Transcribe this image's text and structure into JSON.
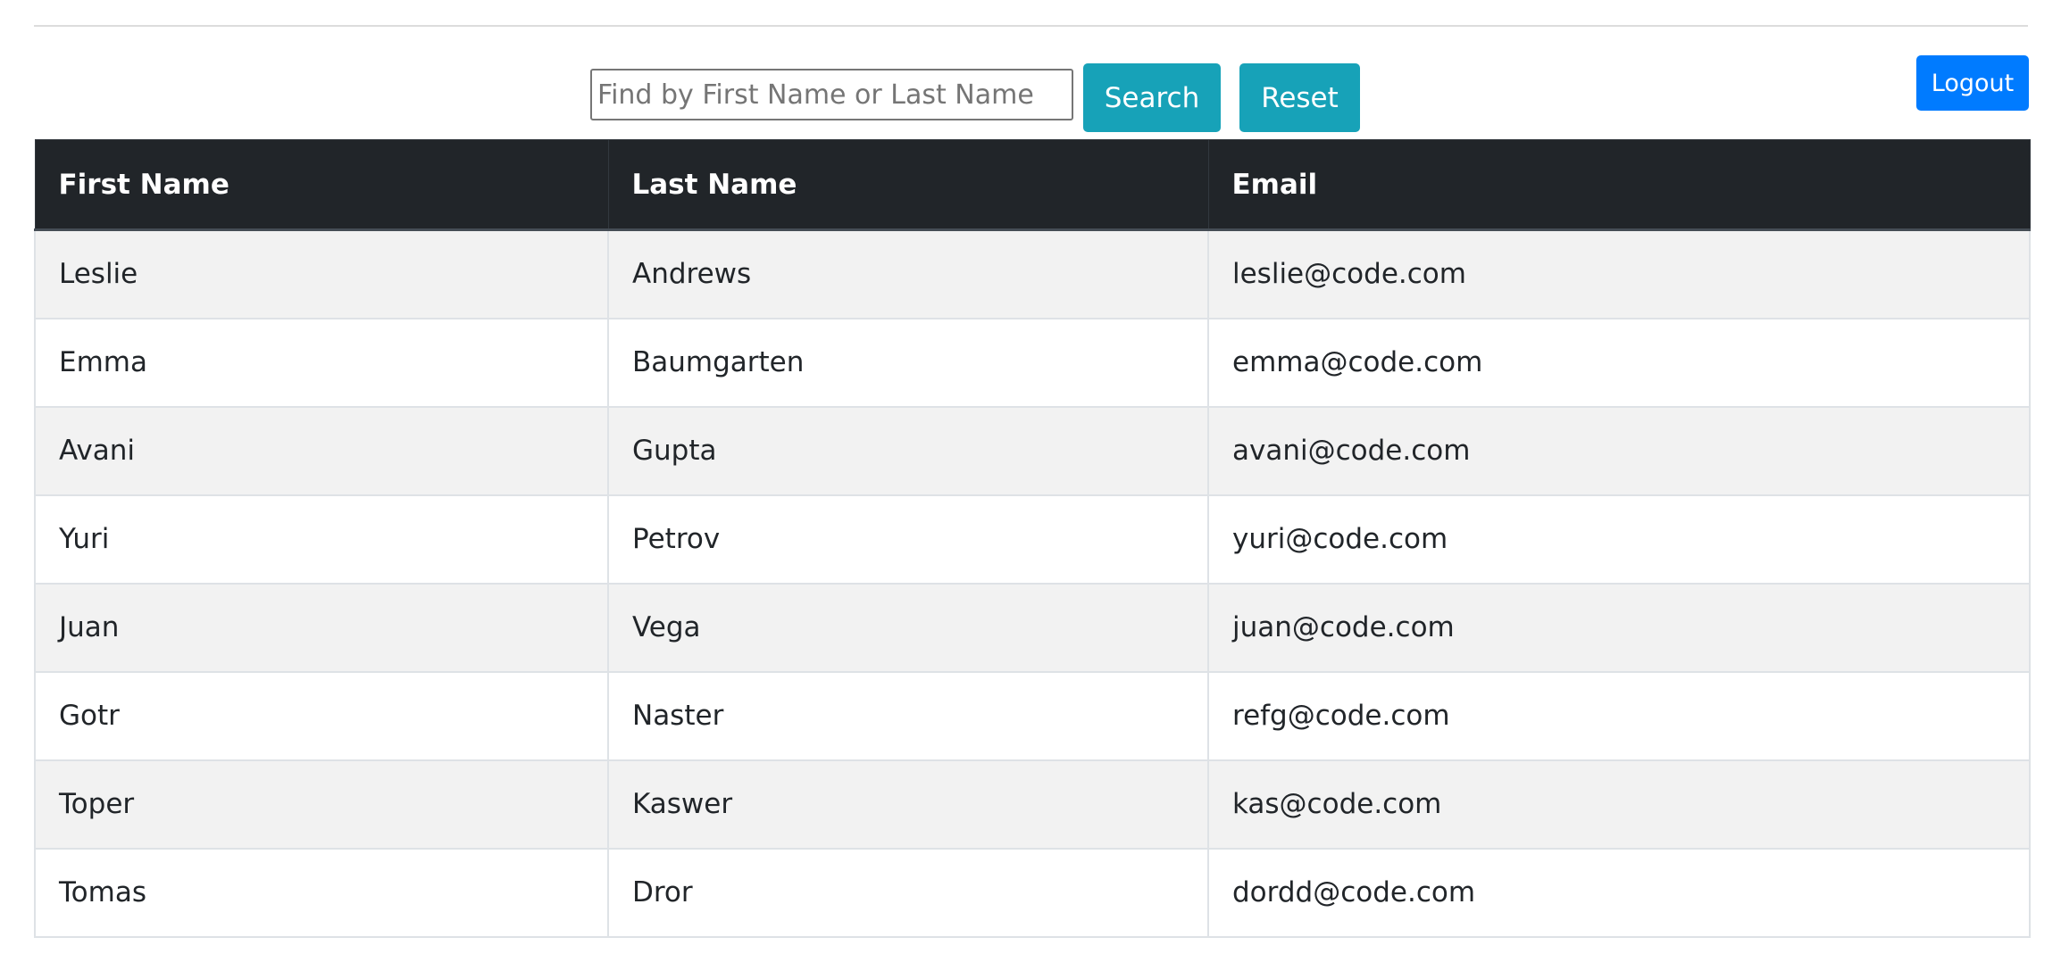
{
  "search": {
    "placeholder": "Find by First Name or Last Name",
    "value": "",
    "search_label": "Search",
    "reset_label": "Reset"
  },
  "header": {
    "logout_label": "Logout"
  },
  "table": {
    "columns": [
      "First Name",
      "Last Name",
      "Email"
    ],
    "rows": [
      {
        "first_name": "Leslie",
        "last_name": "Andrews",
        "email": "leslie@code.com"
      },
      {
        "first_name": "Emma",
        "last_name": "Baumgarten",
        "email": "emma@code.com"
      },
      {
        "first_name": "Avani",
        "last_name": "Gupta",
        "email": "avani@code.com"
      },
      {
        "first_name": "Yuri",
        "last_name": "Petrov",
        "email": "yuri@code.com"
      },
      {
        "first_name": "Juan",
        "last_name": "Vega",
        "email": "juan@code.com"
      },
      {
        "first_name": "Gotr",
        "last_name": "Naster",
        "email": "refg@code.com"
      },
      {
        "first_name": "Toper",
        "last_name": "Kaswer",
        "email": "kas@code.com"
      },
      {
        "first_name": "Tomas",
        "last_name": "Dror",
        "email": "dordd@code.com"
      }
    ]
  },
  "colors": {
    "header_bg": "#212529",
    "info_button": "#17a2b8",
    "primary_button": "#007bff",
    "stripe": "#f2f2f2"
  }
}
